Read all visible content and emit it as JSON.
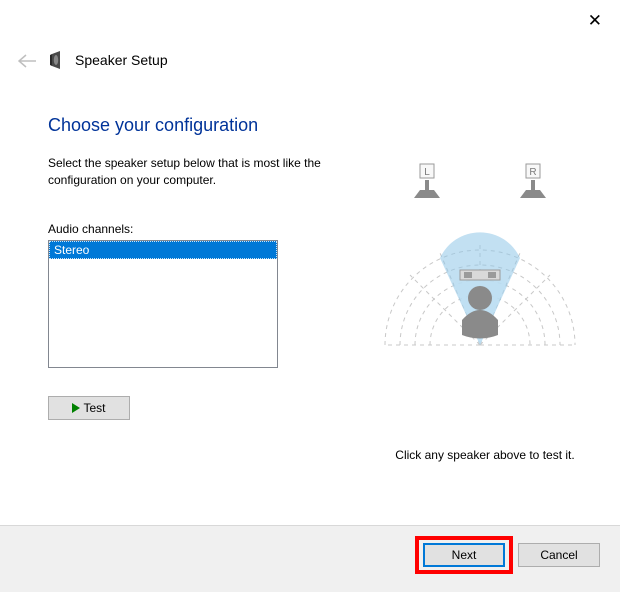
{
  "window": {
    "title": "Speaker Setup"
  },
  "heading": "Choose your configuration",
  "instruction": "Select the speaker setup below that is most like the configuration on your computer.",
  "channels_label": "Audio channels:",
  "channels": {
    "items": [
      "Stereo"
    ],
    "selected": "Stereo"
  },
  "buttons": {
    "test": "Test",
    "next": "Next",
    "cancel": "Cancel"
  },
  "tip": "Click any speaker above to test it.",
  "diagram": {
    "left_label": "L",
    "right_label": "R"
  }
}
